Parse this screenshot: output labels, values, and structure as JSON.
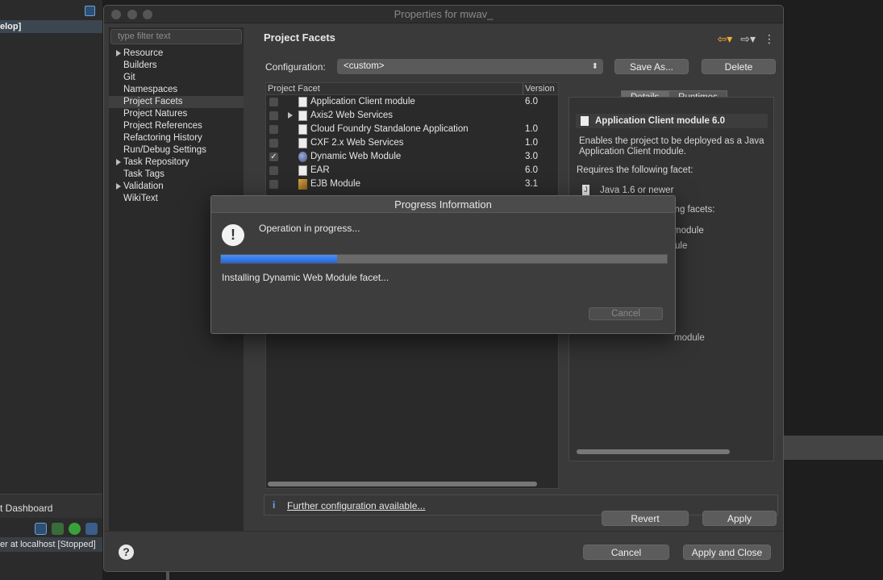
{
  "background": {
    "left_breadcrumb": "elop]",
    "dashboard_label": "t Dashboard",
    "server_label": "er at localhost  [Stopped]"
  },
  "dialog": {
    "title": "Properties for mwav_"
  },
  "sidebar": {
    "filter_placeholder": "type filter text",
    "items": [
      {
        "label": "Resource",
        "expandable": true
      },
      {
        "label": "Builders",
        "expandable": false
      },
      {
        "label": "Git",
        "expandable": false
      },
      {
        "label": "Namespaces",
        "expandable": false
      },
      {
        "label": "Project Facets",
        "expandable": false,
        "selected": true
      },
      {
        "label": "Project Natures",
        "expandable": false
      },
      {
        "label": "Project References",
        "expandable": false
      },
      {
        "label": "Refactoring History",
        "expandable": false
      },
      {
        "label": "Run/Debug Settings",
        "expandable": false
      },
      {
        "label": "Task Repository",
        "expandable": true
      },
      {
        "label": "Task Tags",
        "expandable": false
      },
      {
        "label": "Validation",
        "expandable": true
      },
      {
        "label": "WikiText",
        "expandable": false
      }
    ]
  },
  "content": {
    "title": "Project Facets",
    "configuration_label": "Configuration:",
    "configuration_value": "<custom>",
    "save_as_label": "Save As...",
    "delete_label": "Delete"
  },
  "facets": {
    "col_facet": "Project Facet",
    "col_version": "Version",
    "rows": [
      {
        "name": "Application Client module",
        "version": "6.0",
        "checked": false,
        "expandable": false,
        "icon": "doc"
      },
      {
        "name": "Axis2 Web Services",
        "version": "",
        "checked": false,
        "expandable": true,
        "icon": "doc"
      },
      {
        "name": "Cloud Foundry Standalone Application",
        "version": "1.0",
        "checked": false,
        "expandable": false,
        "icon": "doc"
      },
      {
        "name": "CXF 2.x Web Services",
        "version": "1.0",
        "checked": false,
        "expandable": false,
        "icon": "doc"
      },
      {
        "name": "Dynamic Web Module",
        "version": "3.0",
        "checked": true,
        "expandable": false,
        "icon": "globe"
      },
      {
        "name": "EAR",
        "version": "6.0",
        "checked": false,
        "expandable": false,
        "icon": "doc"
      },
      {
        "name": "EJB Module",
        "version": "3.1",
        "checked": false,
        "expandable": false,
        "icon": "ejb"
      }
    ]
  },
  "details": {
    "tab_details": "Details",
    "tab_runtimes": "Runtimes",
    "title": "Application Client module 6.0",
    "description": "Enables the project to be deployed as a Java Application Client module.",
    "requires_label": "Requires the following facet:",
    "requirement": "Java 1.6 or newer",
    "frag1": "ing facets:",
    "frag2": "module",
    "frag3": "ule",
    "frag4": "module"
  },
  "further": {
    "link": "Further configuration available..."
  },
  "buttons": {
    "revert": "Revert",
    "apply": "Apply",
    "cancel": "Cancel",
    "apply_close": "Apply and Close"
  },
  "progress": {
    "title": "Progress Information",
    "message": "Operation in progress...",
    "task": "Installing Dynamic Web Module facet...",
    "cancel": "Cancel",
    "fraction": 0.26
  }
}
